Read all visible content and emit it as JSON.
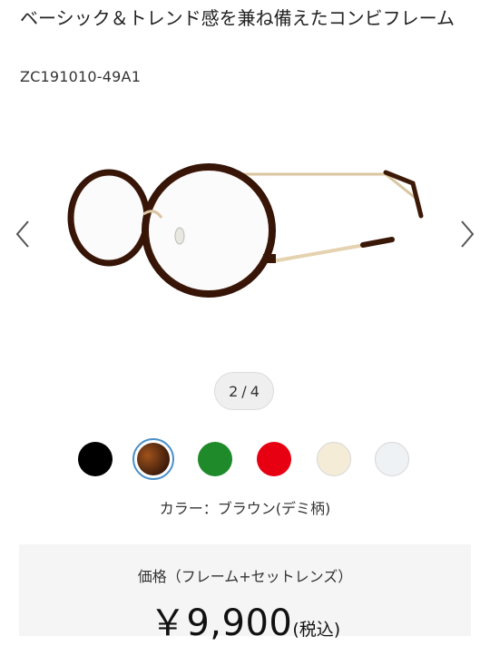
{
  "product": {
    "title": "ベーシック＆トレンド感を兼ね備えたコンビフレーム",
    "sku": "ZC191010-49A1"
  },
  "gallery": {
    "current_page": "2",
    "separator": "/",
    "total_pages": "4",
    "image_icon": "eyeglasses-image",
    "prev_icon": "chevron-left-icon",
    "next_icon": "chevron-right-icon"
  },
  "colors": {
    "swatches": [
      {
        "name": "black",
        "hex": "#000000",
        "selected": false
      },
      {
        "name": "brown-demi",
        "hex": "#5a2c10",
        "selected": true
      },
      {
        "name": "green",
        "hex": "#1f8a2a",
        "selected": false
      },
      {
        "name": "red",
        "hex": "#e60012",
        "selected": false
      },
      {
        "name": "ivory",
        "hex": "#f4ecd6",
        "selected": false
      },
      {
        "name": "clear",
        "hex": "#eef2f4",
        "selected": false
      }
    ],
    "selected_label": "カラー：ブラウン(デミ柄)",
    "selection_border": "#4a90c8"
  },
  "price": {
    "label": "価格（フレーム+セットレンズ）",
    "amount": "￥9,900",
    "tax_note": "(税込)"
  }
}
